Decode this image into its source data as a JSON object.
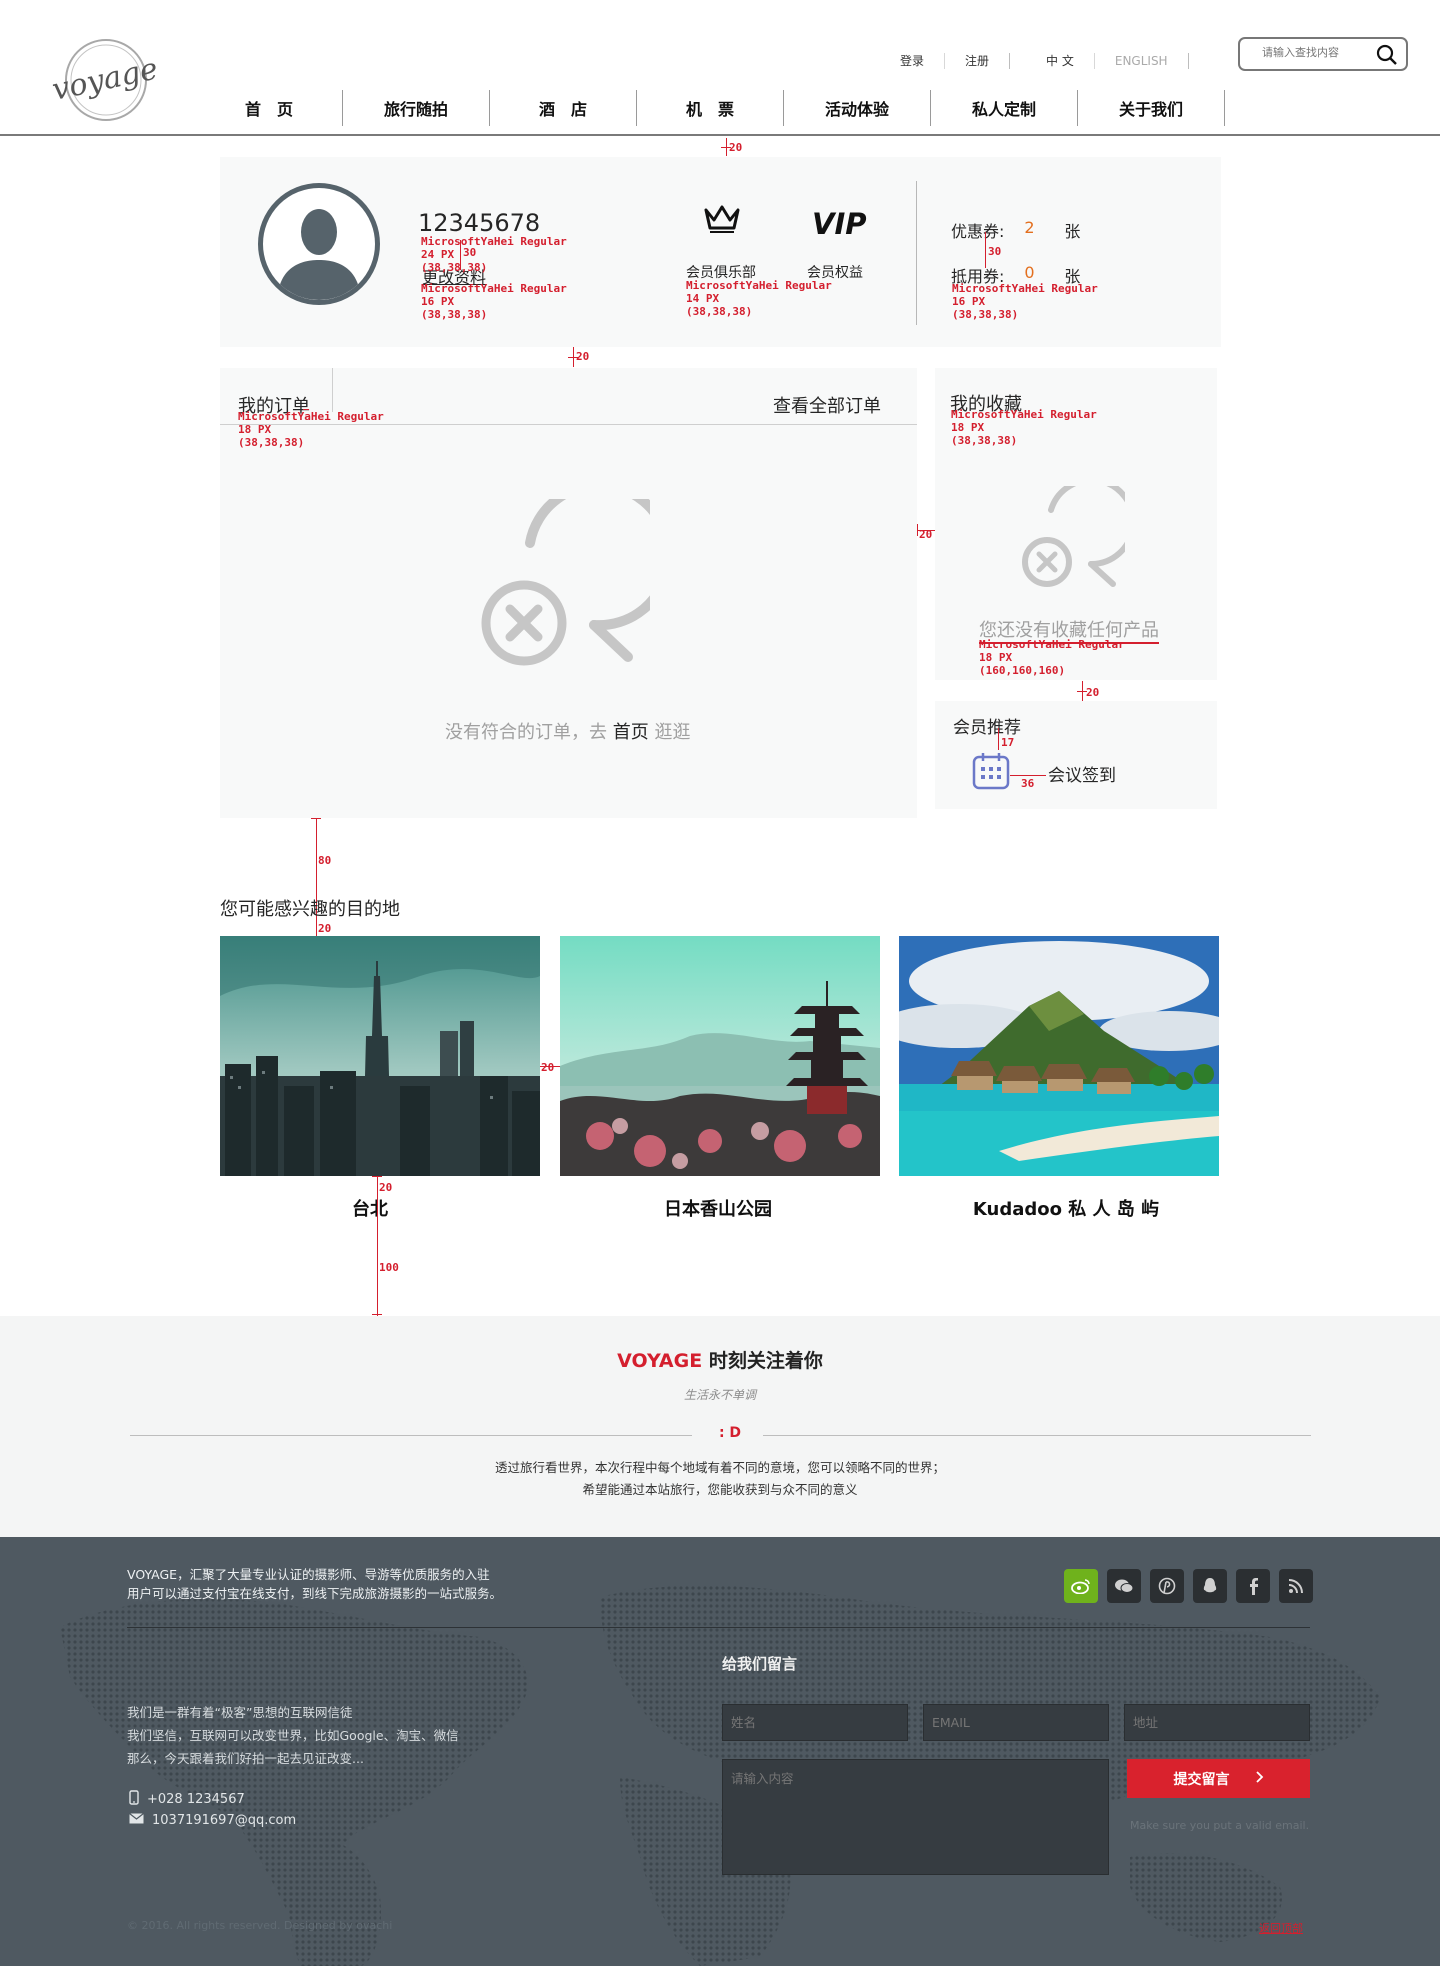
{
  "header": {
    "logo_text": "voyage",
    "top_links": [
      "登录",
      "注册",
      "中 文",
      "ENGLISH"
    ],
    "search_placeholder": "请输入查找内容",
    "nav": [
      "首　页",
      "旅行随拍",
      "酒　店",
      "机　票",
      "活动体验",
      "私人定制",
      "关于我们"
    ]
  },
  "profile": {
    "username": "12345678",
    "edit_label": "更改资料",
    "club_label": "会员俱乐部",
    "vip_text": "VIP",
    "vip_label": "会员权益",
    "coupon_label": "优惠券:",
    "coupon_count": "2",
    "coupon_unit": "张",
    "voucher_label": "抵用券:",
    "voucher_count": "0",
    "voucher_unit": "张"
  },
  "orders": {
    "title": "我的订单",
    "view_all": "查看全部订单",
    "empty_prefix": "没有符合的订单，去",
    "empty_home": "首页",
    "empty_suffix": "逛逛"
  },
  "favorites": {
    "title": "我的收藏",
    "empty": "您还没有收藏任何产品"
  },
  "member": {
    "title": "会员推荐",
    "item_label": "会议签到"
  },
  "destinations": {
    "title": "您可能感兴趣的目的地",
    "items": [
      {
        "name": "台北"
      },
      {
        "name": "日本香山公园"
      },
      {
        "name": "Kudadoo 私 人 岛 屿"
      }
    ]
  },
  "follow": {
    "brand": "VOYAGE",
    "headline_rest": " 时刻关注着你",
    "subtitle": "生活永不单调",
    "smile": ": D",
    "line1": "透过旅行看世界，本次行程中每个地域有着不同的意境，您可以领略不同的世界；",
    "line2": "希望能通过本站旅行，您能收获到与众不同的意义"
  },
  "footer": {
    "intro1": "VOYAGE，汇聚了大量专业认证的摄影师、导游等优质服务的入驻",
    "intro2": "用户可以通过支付宝在线支付，到线下完成旅游摄影的一站式服务。",
    "about1": "我们是一群有着“极客”思想的互联网信徒",
    "about2": "我们坚信，互联网可以改变世界，比如Google、淘宝、微信",
    "about3": "那么，今天跟着我们好拍一起去见证改变...",
    "phone": "+028 1234567",
    "email": "1037191697@qq.com",
    "message_title": "给我们留言",
    "name_ph": "姓名",
    "email_ph": "EMAIL",
    "address_ph": "地址",
    "content_ph": "请输入内容",
    "submit": "提交留言",
    "note": "Make sure you put a valid email.",
    "copyright": "© 2016. All rights reserved. Designed by ovachi",
    "back_top": "返回顶部"
  },
  "annotations": {
    "gap20": "20",
    "gap30": "30",
    "gap17": "17",
    "gap36": "36",
    "gap80": "80",
    "gap100": "100",
    "font": "MicrosoftYaHei Regular",
    "px24": "24 PX",
    "px16": "16 PX",
    "px14": "14 PX",
    "px18": "18 PX",
    "rgb38": "(38,38,38)",
    "rgb160": "(160,160,160)"
  },
  "colors": {
    "accent": "#d41f2e",
    "orange": "#e36f1e",
    "panel_bg": "#f8f9f9",
    "footer_bg": "#4f5961",
    "text": "#262626",
    "muted": "#a0a0a0"
  }
}
